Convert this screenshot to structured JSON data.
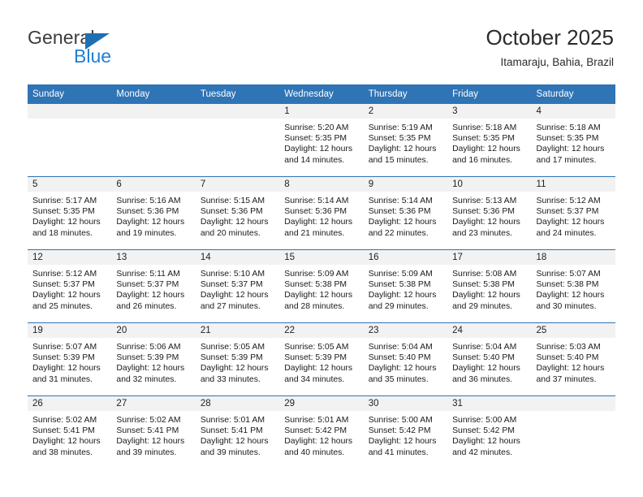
{
  "brand": {
    "name_top": "General",
    "name_bottom": "Blue",
    "color_dark": "#3c3c3c",
    "color_blue": "#1f7fd4"
  },
  "header": {
    "title": "October 2025",
    "subtitle": "Itamaraju, Bahia, Brazil"
  },
  "theme": {
    "header_blue": "#2f74b5",
    "daynum_gray": "#f2f2f2",
    "text": "#1a1a1a"
  },
  "weekdays": [
    "Sunday",
    "Monday",
    "Tuesday",
    "Wednesday",
    "Thursday",
    "Friday",
    "Saturday"
  ],
  "weeks": [
    [
      {
        "day": "",
        "empty": true
      },
      {
        "day": "",
        "empty": true
      },
      {
        "day": "",
        "empty": true
      },
      {
        "day": "1",
        "sunrise": "Sunrise: 5:20 AM",
        "sunset": "Sunset: 5:35 PM",
        "daylight_1": "Daylight: 12 hours",
        "daylight_2": "and 14 minutes."
      },
      {
        "day": "2",
        "sunrise": "Sunrise: 5:19 AM",
        "sunset": "Sunset: 5:35 PM",
        "daylight_1": "Daylight: 12 hours",
        "daylight_2": "and 15 minutes."
      },
      {
        "day": "3",
        "sunrise": "Sunrise: 5:18 AM",
        "sunset": "Sunset: 5:35 PM",
        "daylight_1": "Daylight: 12 hours",
        "daylight_2": "and 16 minutes."
      },
      {
        "day": "4",
        "sunrise": "Sunrise: 5:18 AM",
        "sunset": "Sunset: 5:35 PM",
        "daylight_1": "Daylight: 12 hours",
        "daylight_2": "and 17 minutes."
      }
    ],
    [
      {
        "day": "5",
        "sunrise": "Sunrise: 5:17 AM",
        "sunset": "Sunset: 5:35 PM",
        "daylight_1": "Daylight: 12 hours",
        "daylight_2": "and 18 minutes."
      },
      {
        "day": "6",
        "sunrise": "Sunrise: 5:16 AM",
        "sunset": "Sunset: 5:36 PM",
        "daylight_1": "Daylight: 12 hours",
        "daylight_2": "and 19 minutes."
      },
      {
        "day": "7",
        "sunrise": "Sunrise: 5:15 AM",
        "sunset": "Sunset: 5:36 PM",
        "daylight_1": "Daylight: 12 hours",
        "daylight_2": "and 20 minutes."
      },
      {
        "day": "8",
        "sunrise": "Sunrise: 5:14 AM",
        "sunset": "Sunset: 5:36 PM",
        "daylight_1": "Daylight: 12 hours",
        "daylight_2": "and 21 minutes."
      },
      {
        "day": "9",
        "sunrise": "Sunrise: 5:14 AM",
        "sunset": "Sunset: 5:36 PM",
        "daylight_1": "Daylight: 12 hours",
        "daylight_2": "and 22 minutes."
      },
      {
        "day": "10",
        "sunrise": "Sunrise: 5:13 AM",
        "sunset": "Sunset: 5:36 PM",
        "daylight_1": "Daylight: 12 hours",
        "daylight_2": "and 23 minutes."
      },
      {
        "day": "11",
        "sunrise": "Sunrise: 5:12 AM",
        "sunset": "Sunset: 5:37 PM",
        "daylight_1": "Daylight: 12 hours",
        "daylight_2": "and 24 minutes."
      }
    ],
    [
      {
        "day": "12",
        "sunrise": "Sunrise: 5:12 AM",
        "sunset": "Sunset: 5:37 PM",
        "daylight_1": "Daylight: 12 hours",
        "daylight_2": "and 25 minutes."
      },
      {
        "day": "13",
        "sunrise": "Sunrise: 5:11 AM",
        "sunset": "Sunset: 5:37 PM",
        "daylight_1": "Daylight: 12 hours",
        "daylight_2": "and 26 minutes."
      },
      {
        "day": "14",
        "sunrise": "Sunrise: 5:10 AM",
        "sunset": "Sunset: 5:37 PM",
        "daylight_1": "Daylight: 12 hours",
        "daylight_2": "and 27 minutes."
      },
      {
        "day": "15",
        "sunrise": "Sunrise: 5:09 AM",
        "sunset": "Sunset: 5:38 PM",
        "daylight_1": "Daylight: 12 hours",
        "daylight_2": "and 28 minutes."
      },
      {
        "day": "16",
        "sunrise": "Sunrise: 5:09 AM",
        "sunset": "Sunset: 5:38 PM",
        "daylight_1": "Daylight: 12 hours",
        "daylight_2": "and 29 minutes."
      },
      {
        "day": "17",
        "sunrise": "Sunrise: 5:08 AM",
        "sunset": "Sunset: 5:38 PM",
        "daylight_1": "Daylight: 12 hours",
        "daylight_2": "and 29 minutes."
      },
      {
        "day": "18",
        "sunrise": "Sunrise: 5:07 AM",
        "sunset": "Sunset: 5:38 PM",
        "daylight_1": "Daylight: 12 hours",
        "daylight_2": "and 30 minutes."
      }
    ],
    [
      {
        "day": "19",
        "sunrise": "Sunrise: 5:07 AM",
        "sunset": "Sunset: 5:39 PM",
        "daylight_1": "Daylight: 12 hours",
        "daylight_2": "and 31 minutes."
      },
      {
        "day": "20",
        "sunrise": "Sunrise: 5:06 AM",
        "sunset": "Sunset: 5:39 PM",
        "daylight_1": "Daylight: 12 hours",
        "daylight_2": "and 32 minutes."
      },
      {
        "day": "21",
        "sunrise": "Sunrise: 5:05 AM",
        "sunset": "Sunset: 5:39 PM",
        "daylight_1": "Daylight: 12 hours",
        "daylight_2": "and 33 minutes."
      },
      {
        "day": "22",
        "sunrise": "Sunrise: 5:05 AM",
        "sunset": "Sunset: 5:39 PM",
        "daylight_1": "Daylight: 12 hours",
        "daylight_2": "and 34 minutes."
      },
      {
        "day": "23",
        "sunrise": "Sunrise: 5:04 AM",
        "sunset": "Sunset: 5:40 PM",
        "daylight_1": "Daylight: 12 hours",
        "daylight_2": "and 35 minutes."
      },
      {
        "day": "24",
        "sunrise": "Sunrise: 5:04 AM",
        "sunset": "Sunset: 5:40 PM",
        "daylight_1": "Daylight: 12 hours",
        "daylight_2": "and 36 minutes."
      },
      {
        "day": "25",
        "sunrise": "Sunrise: 5:03 AM",
        "sunset": "Sunset: 5:40 PM",
        "daylight_1": "Daylight: 12 hours",
        "daylight_2": "and 37 minutes."
      }
    ],
    [
      {
        "day": "26",
        "sunrise": "Sunrise: 5:02 AM",
        "sunset": "Sunset: 5:41 PM",
        "daylight_1": "Daylight: 12 hours",
        "daylight_2": "and 38 minutes."
      },
      {
        "day": "27",
        "sunrise": "Sunrise: 5:02 AM",
        "sunset": "Sunset: 5:41 PM",
        "daylight_1": "Daylight: 12 hours",
        "daylight_2": "and 39 minutes."
      },
      {
        "day": "28",
        "sunrise": "Sunrise: 5:01 AM",
        "sunset": "Sunset: 5:41 PM",
        "daylight_1": "Daylight: 12 hours",
        "daylight_2": "and 39 minutes."
      },
      {
        "day": "29",
        "sunrise": "Sunrise: 5:01 AM",
        "sunset": "Sunset: 5:42 PM",
        "daylight_1": "Daylight: 12 hours",
        "daylight_2": "and 40 minutes."
      },
      {
        "day": "30",
        "sunrise": "Sunrise: 5:00 AM",
        "sunset": "Sunset: 5:42 PM",
        "daylight_1": "Daylight: 12 hours",
        "daylight_2": "and 41 minutes."
      },
      {
        "day": "31",
        "sunrise": "Sunrise: 5:00 AM",
        "sunset": "Sunset: 5:42 PM",
        "daylight_1": "Daylight: 12 hours",
        "daylight_2": "and 42 minutes."
      },
      {
        "day": "",
        "empty": true
      }
    ]
  ]
}
